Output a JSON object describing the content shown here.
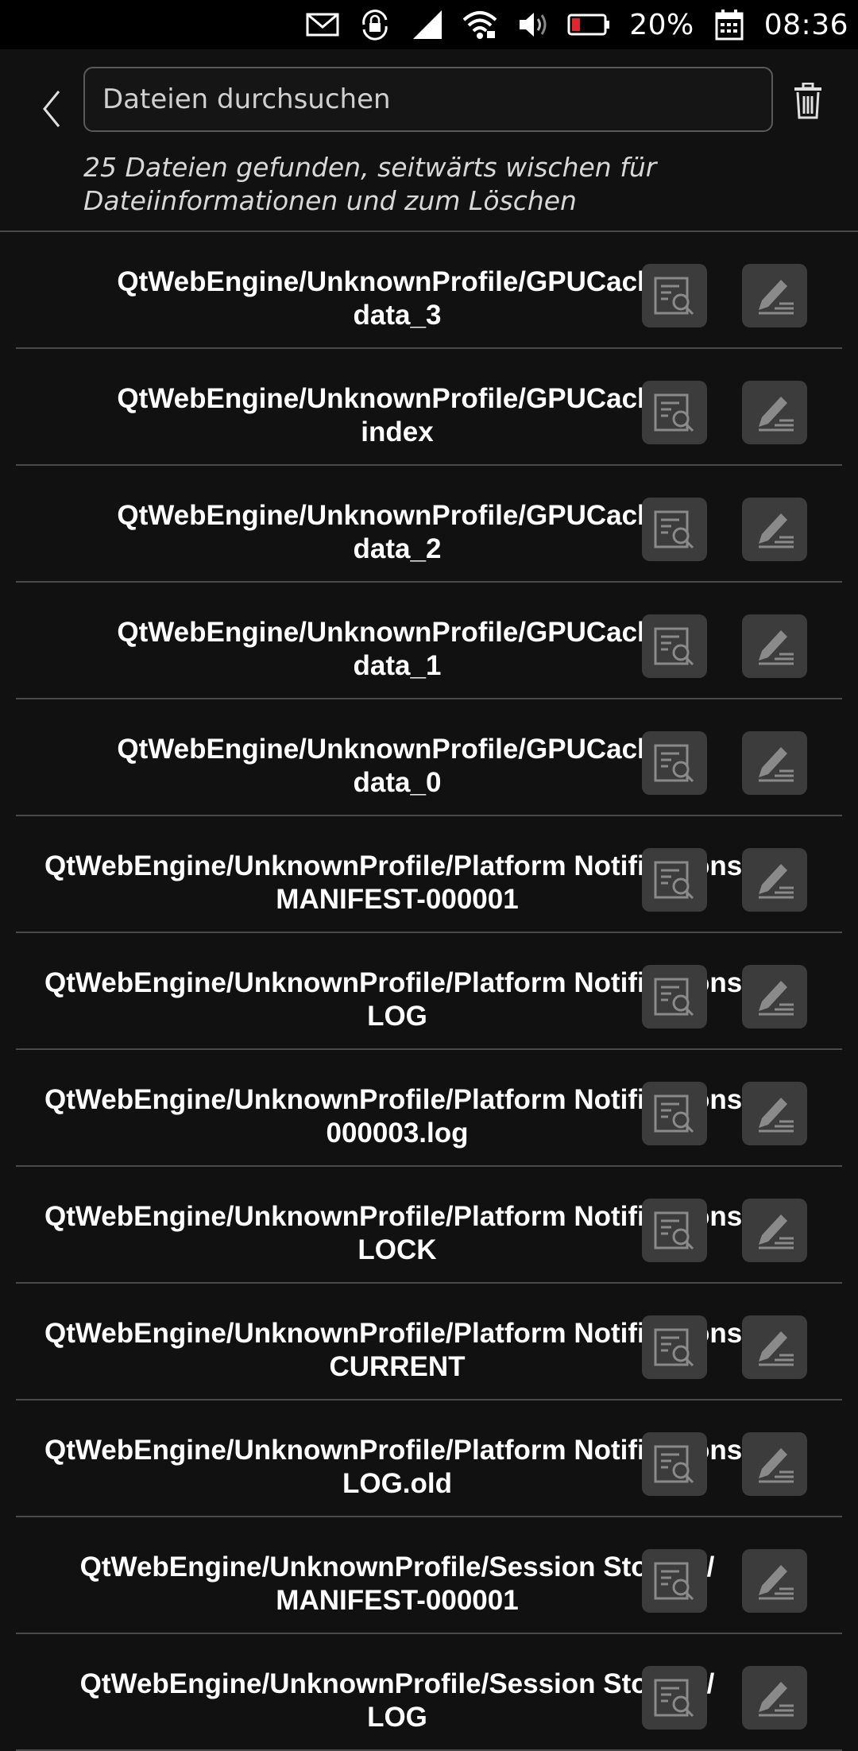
{
  "statusbar": {
    "battery_percent": "20%",
    "time": "08:36",
    "icons": [
      "mail-icon",
      "lock-rotation-icon",
      "cell-signal-icon",
      "wifi-icon",
      "volume-icon",
      "battery-icon",
      "calendar-icon"
    ]
  },
  "header": {
    "search_placeholder": "Dateien durchsuchen",
    "hint": "25 Dateien gefunden, seitwärts wischen für Dateiinformationen und zum Löschen"
  },
  "rows": [
    {
      "line1": "QtWebEngine/UnknownProfile/GPUCache/",
      "line2": "data_3"
    },
    {
      "line1": "QtWebEngine/UnknownProfile/GPUCache/",
      "line2": "index"
    },
    {
      "line1": "QtWebEngine/UnknownProfile/GPUCache/",
      "line2": "data_2"
    },
    {
      "line1": "QtWebEngine/UnknownProfile/GPUCache/",
      "line2": "data_1"
    },
    {
      "line1": "QtWebEngine/UnknownProfile/GPUCache/",
      "line2": "data_0"
    },
    {
      "line1": "QtWebEngine/UnknownProfile/Platform Notifications/",
      "line2": "MANIFEST-000001"
    },
    {
      "line1": "QtWebEngine/UnknownProfile/Platform Notifications/",
      "line2": "LOG"
    },
    {
      "line1": "QtWebEngine/UnknownProfile/Platform Notifications/",
      "line2": "000003.log"
    },
    {
      "line1": "QtWebEngine/UnknownProfile/Platform Notifications/",
      "line2": "LOCK"
    },
    {
      "line1": "QtWebEngine/UnknownProfile/Platform Notifications/",
      "line2": "CURRENT"
    },
    {
      "line1": "QtWebEngine/UnknownProfile/Platform Notifications/",
      "line2": "LOG.old"
    },
    {
      "line1": "QtWebEngine/UnknownProfile/Session Storage/",
      "line2": "MANIFEST-000001"
    },
    {
      "line1": "QtWebEngine/UnknownProfile/Session Storage/",
      "line2": "LOG"
    }
  ],
  "colors": {
    "background": "#111111",
    "statusbar": "#000000",
    "battery_low": "#e0262e",
    "button_bg": "#3c3c3c"
  }
}
